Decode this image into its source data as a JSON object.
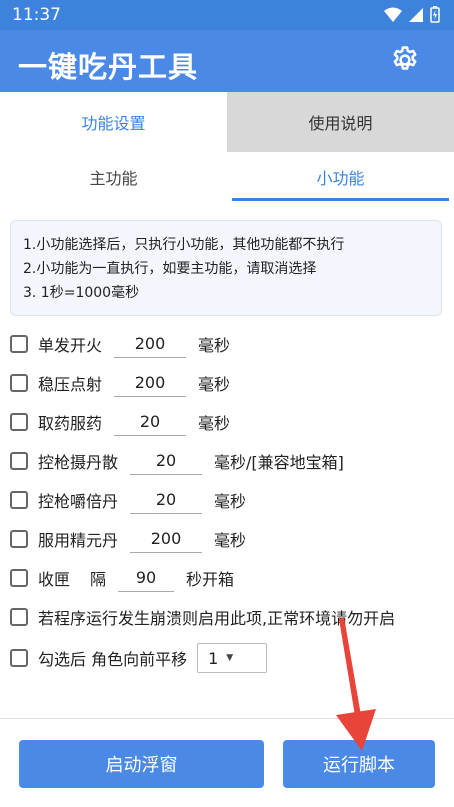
{
  "status_bar": {
    "time": "11:37"
  },
  "app_bar": {
    "title": "一键吃丹工具",
    "settings_icon": "gear-icon"
  },
  "top_tabs": [
    {
      "label": "功能设置",
      "active": true
    },
    {
      "label": "使用说明",
      "active": false
    }
  ],
  "sub_tabs": [
    {
      "label": "主功能",
      "active": false
    },
    {
      "label": "小功能",
      "active": true
    }
  ],
  "notice": {
    "lines": [
      "1.小功能选择后，只执行小功能，其他功能都不执行",
      "2.小功能为一直执行，如要主功能，请取消选择",
      "3. 1秒=1000毫秒"
    ]
  },
  "options": [
    {
      "label": "单发开火",
      "value": "200",
      "unit": "毫秒",
      "checked": false
    },
    {
      "label": "稳压点射",
      "value": "200",
      "unit": "毫秒",
      "checked": false
    },
    {
      "label": "取药服药",
      "value": "20",
      "unit": "毫秒",
      "checked": false
    },
    {
      "label": "控枪摄丹散",
      "value": "20",
      "unit": "毫秒/[兼容地宝箱]",
      "checked": false
    },
    {
      "label": "控枪嚼倍丹",
      "value": "20",
      "unit": "毫秒",
      "checked": false
    },
    {
      "label": "服用精元丹",
      "value": "200",
      "unit": "毫秒",
      "checked": false
    },
    {
      "label": "收匣",
      "prefix": "隔",
      "value": "90",
      "unit": "秒开箱",
      "checked": false
    },
    {
      "label": "若程序运行发生崩溃则启用此项,正常环境请勿开启",
      "checked": false
    },
    {
      "label": "勾选后 角色向前平移",
      "dropdown": "1",
      "checked": false
    }
  ],
  "buttons": {
    "float_window": "启动浮窗",
    "run_script": "运行脚本"
  },
  "colors": {
    "primary": "#4a8ae6",
    "accent_text": "#3d83de",
    "annotation_arrow": "#e8443a"
  }
}
